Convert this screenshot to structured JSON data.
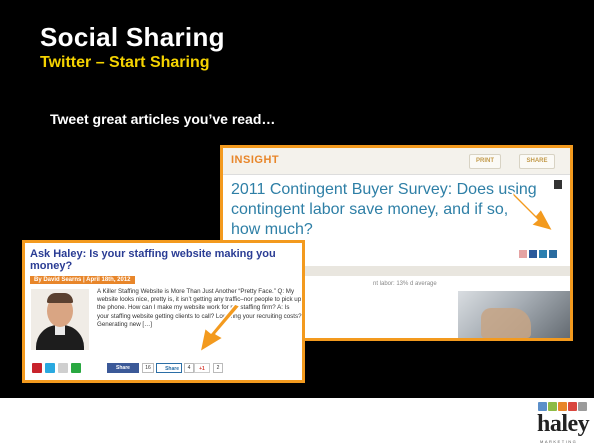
{
  "slide": {
    "title": "Social Sharing",
    "subtitle": "Twitter – Start Sharing",
    "bullet": "Tweet great articles you’ve read…"
  },
  "insight": {
    "label": "INSIGHT",
    "print": "PRINT",
    "share": "SHARE",
    "headline": "2011 Contingent Buyer Survey: Does using contingent labor save money, and if so, how much?",
    "body": "nt labor: 13% d average"
  },
  "article": {
    "title": "Ask Haley: Is your staffing website making you money?",
    "byline": "By David Searns | April 18th, 2012",
    "excerpt": "A Killer Staffing Website is More Than Just Another “Pretty Face.” Q: My website looks nice, pretty is, it isn’t getting any traffic–nor people to pick up the phone. How can I make my website work for my staffing firm? A: Is your staffing website getting clients to call? Lowering your recruiting costs? Generating new […]",
    "fb_label": "Share",
    "fb_count": "16",
    "li_label": "Share",
    "li_count": "4",
    "gplus_label": "+1",
    "gplus_count": "2"
  },
  "logo": {
    "word": "haley",
    "sub": "MARKETING"
  },
  "colors": {
    "accent": "#f39a1e",
    "title_yellow": "#f5d300",
    "link_blue": "#2e7fa6",
    "article_blue": "#2a3c94"
  }
}
